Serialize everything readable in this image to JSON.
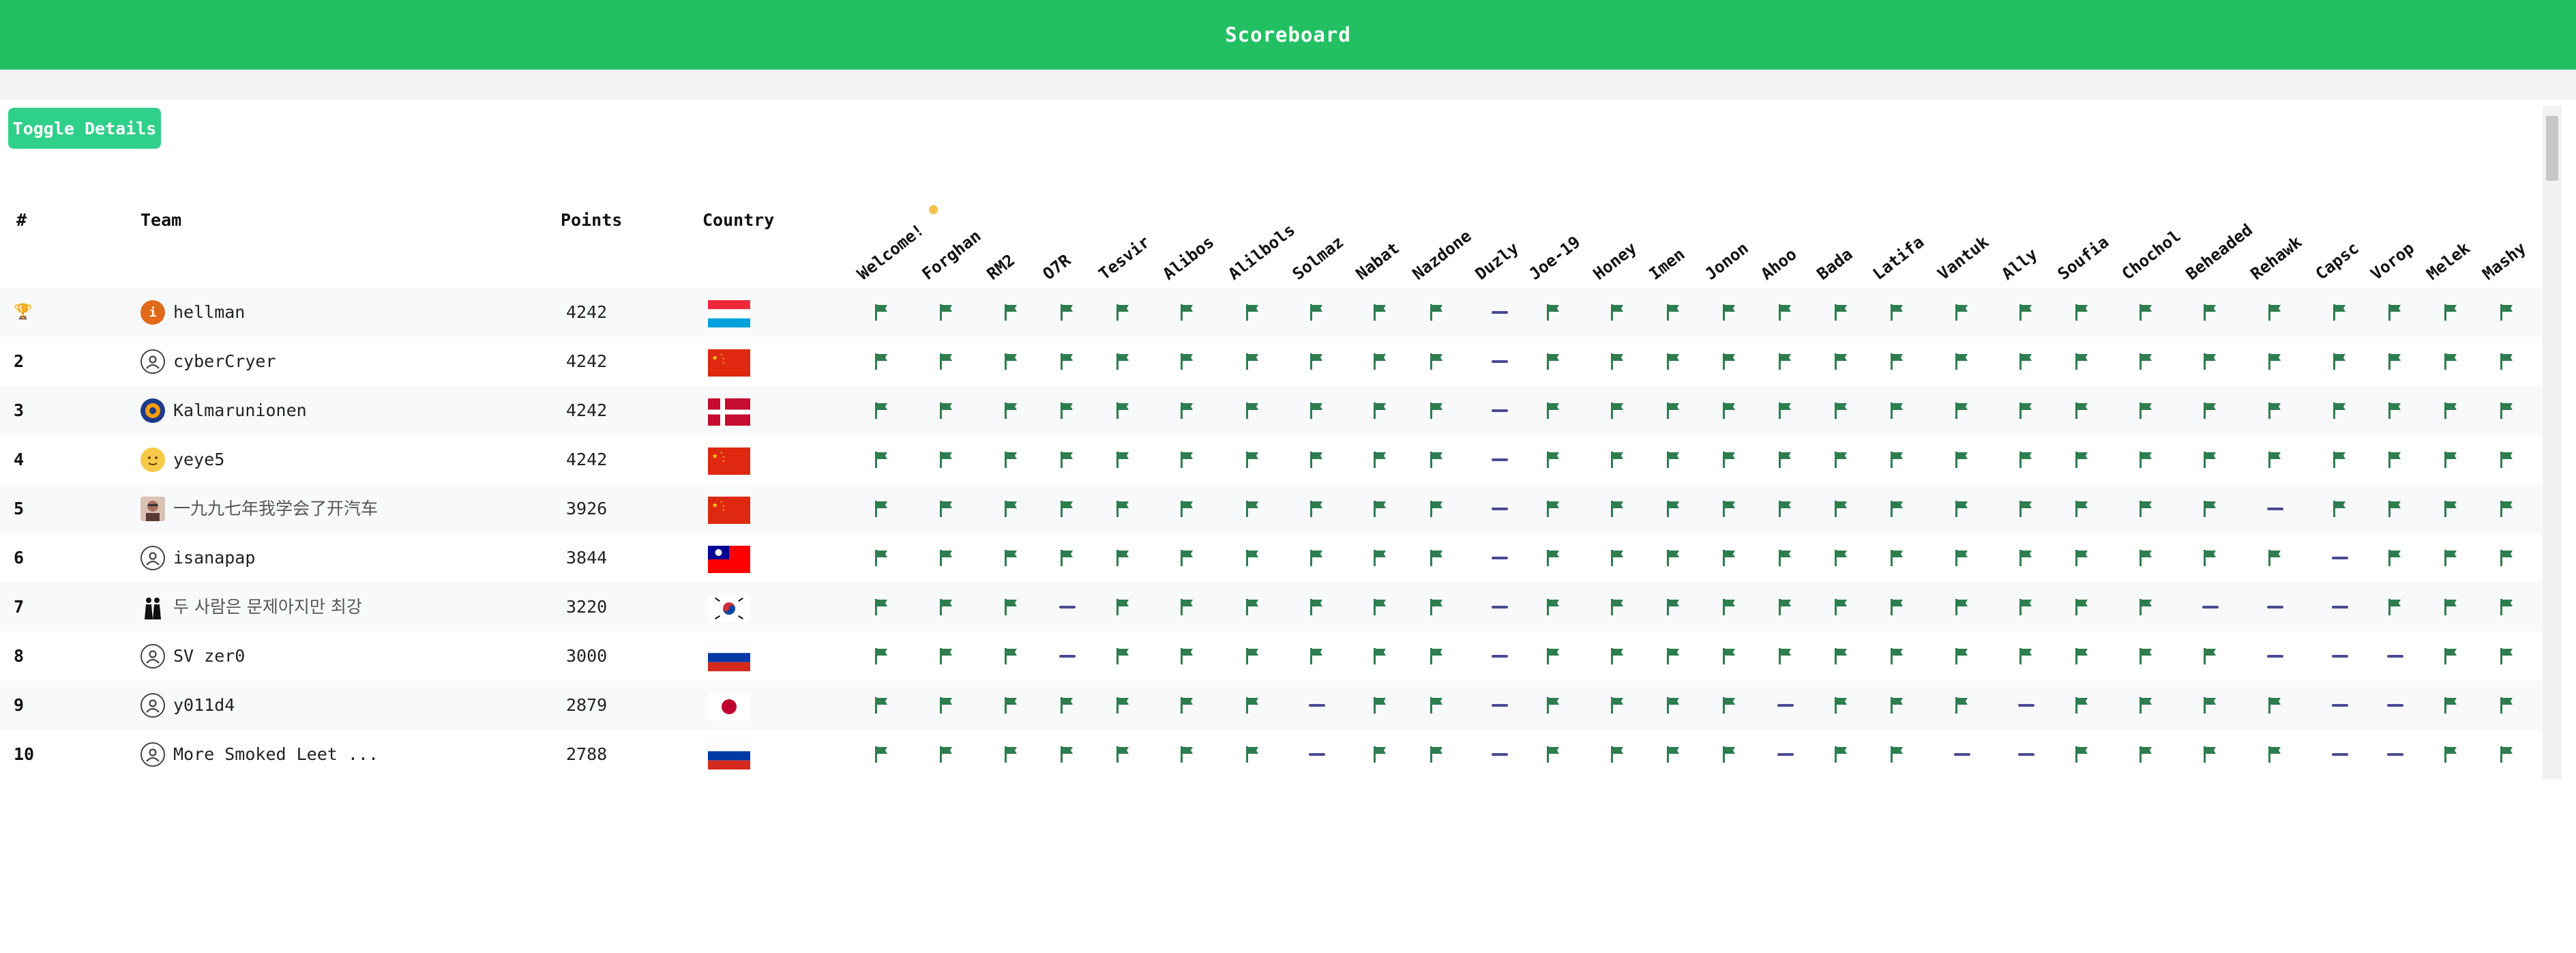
{
  "header": {
    "title": "Scoreboard"
  },
  "toggle_label": "Toggle Details",
  "table": {
    "headers": {
      "rank": "#",
      "team": "Team",
      "points": "Points",
      "country": "Country"
    },
    "challenges": [
      "Welcome!",
      "Forghan",
      "RM2",
      "O7R",
      "Tesvir",
      "Alibos",
      "Alilbols",
      "Solmaz",
      "Nabat",
      "Nazdone",
      "Duzly",
      "Joe-19",
      "Honey",
      "Imen",
      "Jonon",
      "Ahoo",
      "Bada",
      "Latifa",
      "Vantuk",
      "Ally",
      "Soufia",
      "Chochol",
      "Beheaded",
      "Rehawk",
      "Capsc",
      "Vorop",
      "Melek",
      "Mashy"
    ],
    "rows": [
      {
        "rank": "🏆",
        "team": "hellman",
        "points": "4242",
        "country": "LU",
        "avatar": "orange-icon",
        "solved": [
          1,
          1,
          1,
          1,
          1,
          1,
          1,
          1,
          1,
          1,
          0,
          1,
          1,
          1,
          1,
          1,
          1,
          1,
          1,
          1,
          1,
          1,
          1,
          1,
          1,
          1,
          1,
          1
        ]
      },
      {
        "rank": "2",
        "team": "cyberCryer",
        "points": "4242",
        "country": "CN",
        "avatar": "user-icon",
        "solved": [
          1,
          1,
          1,
          1,
          1,
          1,
          1,
          1,
          1,
          1,
          0,
          1,
          1,
          1,
          1,
          1,
          1,
          1,
          1,
          1,
          1,
          1,
          1,
          1,
          1,
          1,
          1,
          1
        ]
      },
      {
        "rank": "3",
        "team": "Kalmarunionen",
        "points": "4242",
        "country": "DK",
        "avatar": "team-logo-icon",
        "solved": [
          1,
          1,
          1,
          1,
          1,
          1,
          1,
          1,
          1,
          1,
          0,
          1,
          1,
          1,
          1,
          1,
          1,
          1,
          1,
          1,
          1,
          1,
          1,
          1,
          1,
          1,
          1,
          1
        ]
      },
      {
        "rank": "4",
        "team": "yeye5",
        "points": "4242",
        "country": "CN",
        "avatar": "emoji-face-icon",
        "solved": [
          1,
          1,
          1,
          1,
          1,
          1,
          1,
          1,
          1,
          1,
          0,
          1,
          1,
          1,
          1,
          1,
          1,
          1,
          1,
          1,
          1,
          1,
          1,
          1,
          1,
          1,
          1,
          1
        ]
      },
      {
        "rank": "5",
        "team": "一九九七年我学会了开汽车",
        "points": "3926",
        "country": "CN",
        "avatar": "photo-avatar-icon",
        "solved": [
          1,
          1,
          1,
          1,
          1,
          1,
          1,
          1,
          1,
          1,
          0,
          1,
          1,
          1,
          1,
          1,
          1,
          1,
          1,
          1,
          1,
          1,
          1,
          0,
          1,
          1,
          1,
          1
        ]
      },
      {
        "rank": "6",
        "team": "isanapap",
        "points": "3844",
        "country": "TW",
        "avatar": "user-icon",
        "solved": [
          1,
          1,
          1,
          1,
          1,
          1,
          1,
          1,
          1,
          1,
          0,
          1,
          1,
          1,
          1,
          1,
          1,
          1,
          1,
          1,
          1,
          1,
          1,
          1,
          0,
          1,
          1,
          1
        ]
      },
      {
        "rank": "7",
        "team": "두 사람은 문제아지만 최강",
        "points": "3220",
        "country": "KR",
        "avatar": "duo-silhouette-icon",
        "solved": [
          1,
          1,
          1,
          0,
          1,
          1,
          1,
          1,
          1,
          1,
          0,
          1,
          1,
          1,
          1,
          1,
          1,
          1,
          1,
          1,
          1,
          1,
          0,
          0,
          0,
          1,
          1,
          1
        ]
      },
      {
        "rank": "8",
        "team": "SV zer0",
        "points": "3000",
        "country": "RU",
        "avatar": "user-icon",
        "solved": [
          1,
          1,
          1,
          0,
          1,
          1,
          1,
          1,
          1,
          1,
          0,
          1,
          1,
          1,
          1,
          1,
          1,
          1,
          1,
          1,
          1,
          1,
          1,
          0,
          0,
          0,
          1,
          1
        ]
      },
      {
        "rank": "9",
        "team": "y011d4",
        "points": "2879",
        "country": "JP",
        "avatar": "user-icon",
        "solved": [
          1,
          1,
          1,
          1,
          1,
          1,
          1,
          0,
          1,
          1,
          0,
          1,
          1,
          1,
          1,
          0,
          1,
          1,
          1,
          0,
          1,
          1,
          1,
          1,
          0,
          0,
          1,
          1
        ]
      },
      {
        "rank": "10",
        "team": "More Smoked Leet ...",
        "points": "2788",
        "country": "RU",
        "avatar": "user-icon",
        "solved": [
          1,
          1,
          1,
          1,
          1,
          1,
          1,
          0,
          1,
          1,
          0,
          1,
          1,
          1,
          1,
          0,
          1,
          1,
          0,
          0,
          1,
          1,
          1,
          1,
          0,
          0,
          1,
          1
        ]
      }
    ]
  },
  "colors": {
    "accent": "#22c062",
    "toggle": "#2fd08a",
    "flag": "#2e7d4f",
    "dash": "#4a4a92",
    "medal": "#f2c24d"
  }
}
